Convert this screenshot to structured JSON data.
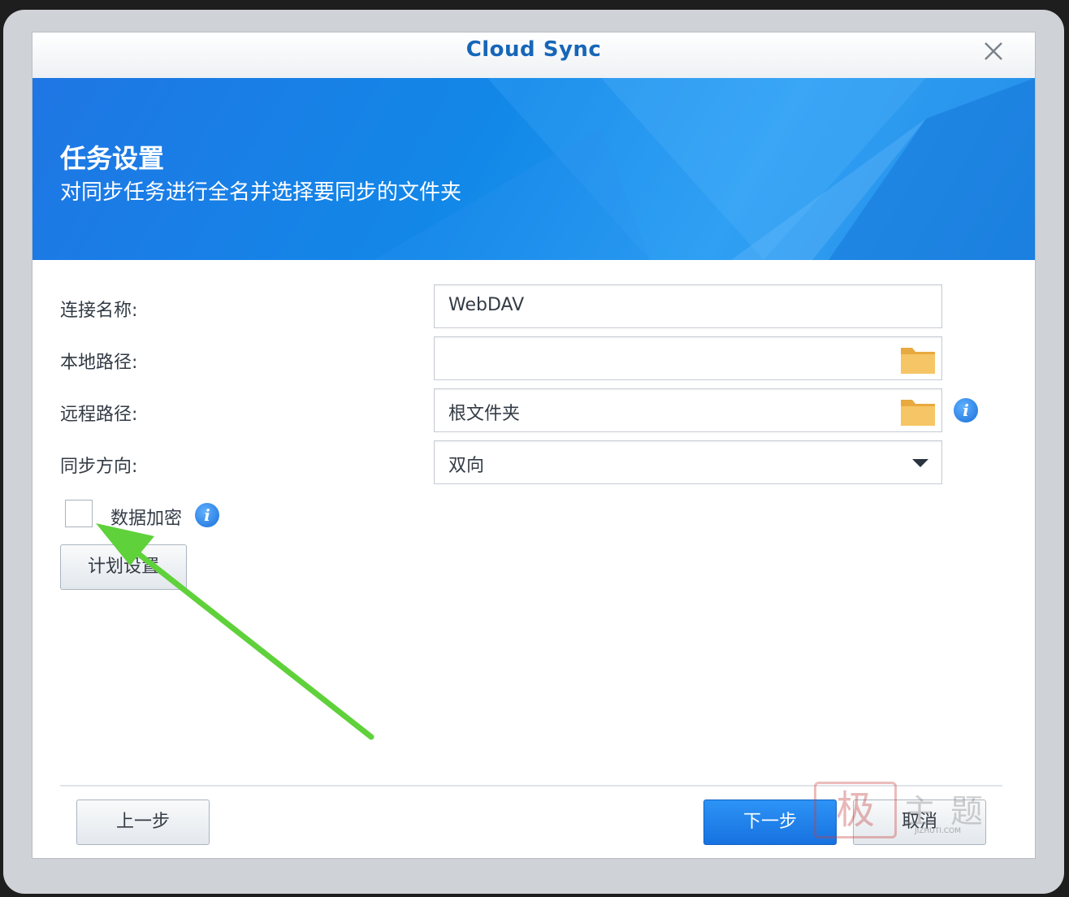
{
  "window": {
    "title": "Cloud Sync",
    "close_icon": "close-icon"
  },
  "banner": {
    "title": "任务设置",
    "subtitle": "对同步任务进行全名并选择要同步的文件夹"
  },
  "form": {
    "connection_name": {
      "label": "连接名称:",
      "value": "WebDAV"
    },
    "local_path": {
      "label": "本地路径:",
      "value": ""
    },
    "remote_path": {
      "label": "远程路径:",
      "value": "根文件夹"
    },
    "sync_direction": {
      "label": "同步方向:",
      "value": "双向"
    },
    "encryption": {
      "label": "数据加密",
      "checked": false
    }
  },
  "buttons": {
    "schedule": "计划设置",
    "back": "上一步",
    "next": "下一步",
    "cancel": "取消"
  },
  "watermark": {
    "seal": "极",
    "text": "主题",
    "url": "JIZHUTI.COM"
  },
  "colors": {
    "title": "#1766b8",
    "banner": "#1a7fe6",
    "primary_button": "#1f82ec",
    "annotation_arrow": "#5fd13a",
    "folder": "#f0b955",
    "info": "#1a6fd8"
  }
}
